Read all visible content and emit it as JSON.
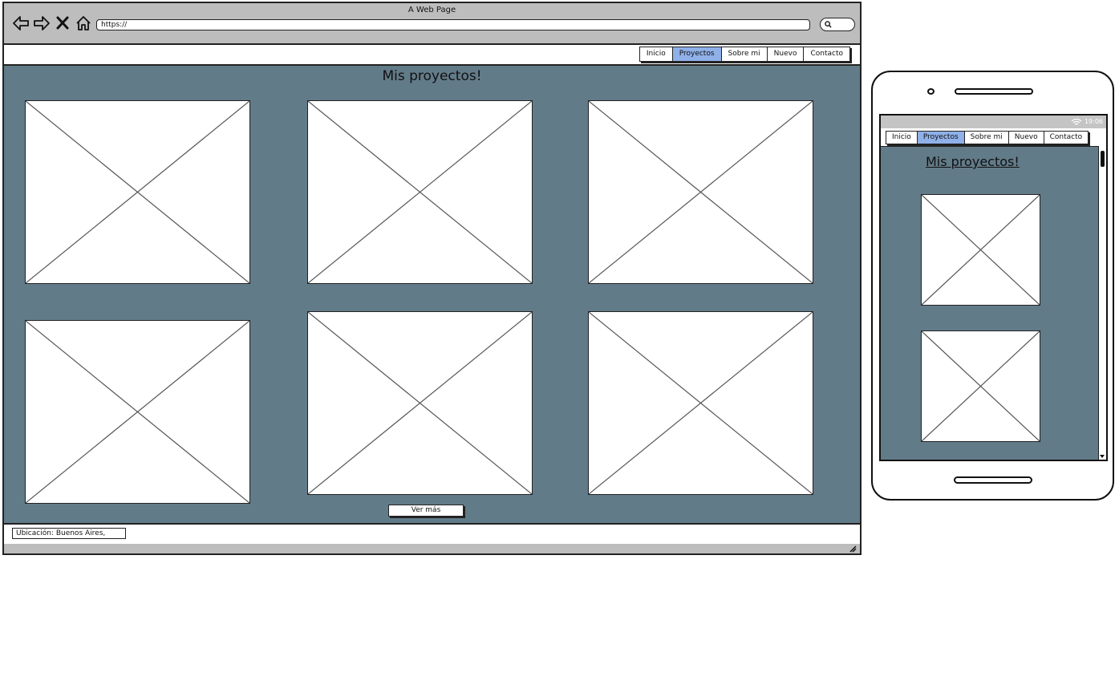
{
  "browser": {
    "title": "A Web Page",
    "url": "https://",
    "nav_icons": [
      "back-arrow-icon",
      "forward-arrow-icon",
      "close-x-icon",
      "home-icon"
    ]
  },
  "nav": {
    "tabs": [
      {
        "label": "Inicio",
        "active": false
      },
      {
        "label": "Proyectos",
        "active": true
      },
      {
        "label": "Sobre mi",
        "active": false
      },
      {
        "label": "Nuevo",
        "active": false
      },
      {
        "label": "Contacto",
        "active": false
      }
    ]
  },
  "main": {
    "title": "Mis proyectos!",
    "more_button": "Ver más"
  },
  "footer": {
    "location": "Ubicación:  Buenos Aires,"
  },
  "phone": {
    "status_time": "19:06",
    "title": "Mis proyectos!",
    "tabs": [
      {
        "label": "Inicio",
        "active": false
      },
      {
        "label": "Proyectos",
        "active": true
      },
      {
        "label": "Sobre mi",
        "active": false
      },
      {
        "label": "Nuevo",
        "active": false
      },
      {
        "label": "Contacto",
        "active": false
      }
    ]
  },
  "colors": {
    "content_bg": "#627b89",
    "chrome_bg": "#bdbdbd",
    "active_tab": "#8fb0e8"
  }
}
